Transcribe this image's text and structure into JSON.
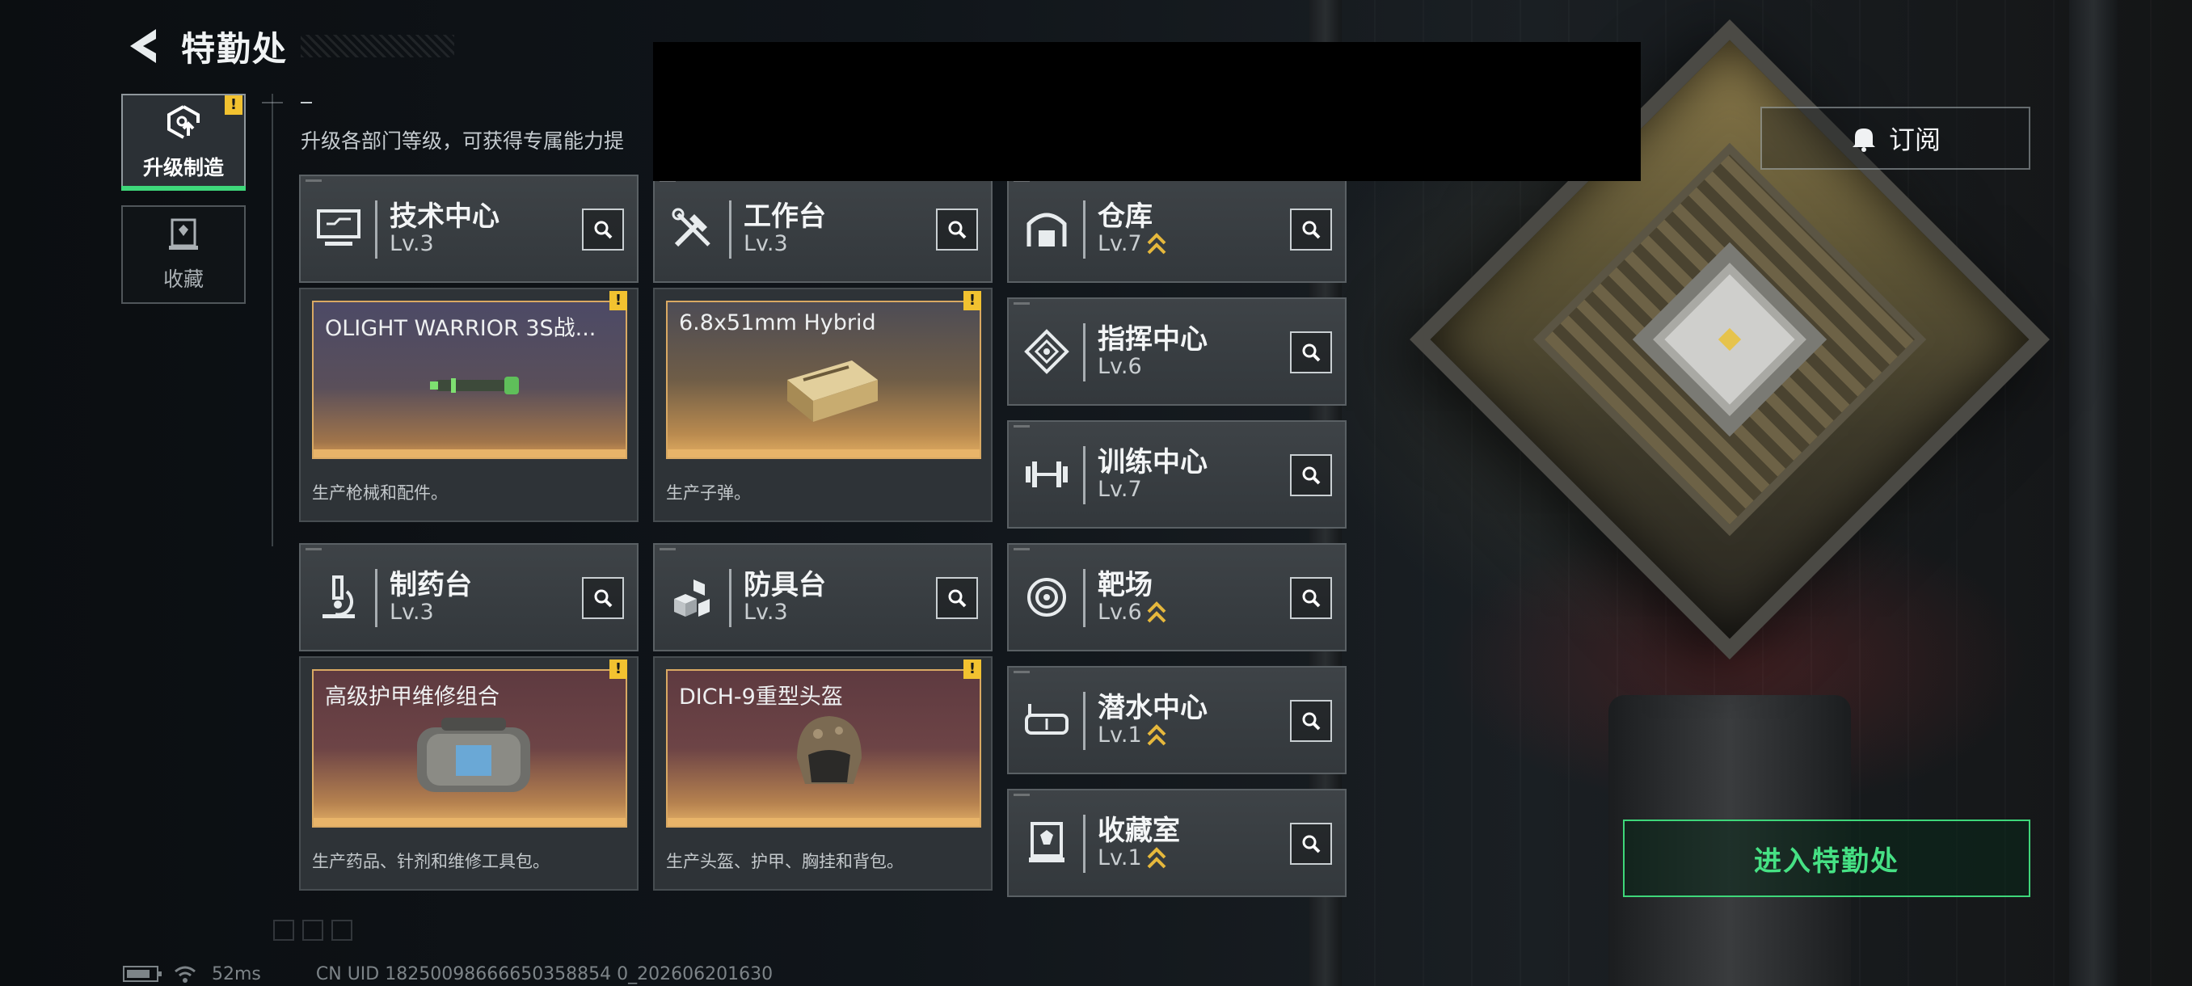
{
  "header": {
    "title": "特勤处"
  },
  "tabs": [
    {
      "label": "升级制造",
      "active": true,
      "warning": "!"
    },
    {
      "label": "收藏",
      "active": false
    }
  ],
  "subtitle": "升级各部门等级，可获得专属能力提",
  "subscribe": {
    "label": "订阅",
    "icon": "bell-icon"
  },
  "enter_button": {
    "label": "进入特勤处"
  },
  "departments": {
    "tech": {
      "name": "技术中心",
      "level": "Lv.3",
      "icon": "monitor-icon"
    },
    "workbench": {
      "name": "工作台",
      "level": "Lv.3",
      "icon": "tools-icon"
    },
    "warehouse": {
      "name": "仓库",
      "level": "Lv.7",
      "icon": "warehouse-icon",
      "upgradable": true
    },
    "command": {
      "name": "指挥中心",
      "level": "Lv.6",
      "icon": "chip-icon"
    },
    "training": {
      "name": "训练中心",
      "level": "Lv.7",
      "icon": "dumbbell-icon"
    },
    "pharmacy": {
      "name": "制药台",
      "level": "Lv.3",
      "icon": "microscope-icon"
    },
    "armor": {
      "name": "防具台",
      "level": "Lv.3",
      "icon": "boxes-icon"
    },
    "range": {
      "name": "靶场",
      "level": "Lv.6",
      "icon": "target-icon",
      "upgradable": true
    },
    "diving": {
      "name": "潜水中心",
      "level": "Lv.1",
      "icon": "goggles-icon",
      "upgradable": true
    },
    "collection": {
      "name": "收藏室",
      "level": "Lv.1",
      "icon": "trophy-icon",
      "upgradable": true
    }
  },
  "production": {
    "tech": {
      "item": "OLIGHT WARRIOR 3S战...",
      "desc": "生产枪械和配件。",
      "warning": "!"
    },
    "workbench": {
      "item": "6.8x51mm Hybrid",
      "desc": "生产子弹。",
      "warning": "!"
    },
    "pharmacy": {
      "item": "高级护甲维修组合",
      "desc": "生产药品、针剂和维修工具包。",
      "warning": "!"
    },
    "armor": {
      "item": "DICH-9重型头盔",
      "desc": "生产头盔、护甲、胸挂和背包。",
      "warning": "!"
    }
  },
  "status_bar": {
    "ping": "52ms",
    "uid": "CN UID 18250098666650358854 0_202606201630"
  },
  "colors": {
    "accent_green": "#3ed77a",
    "warning_yellow": "#f2c230",
    "upgrade_gold": "#e6b83c",
    "frame_orange": "#d9a963"
  }
}
